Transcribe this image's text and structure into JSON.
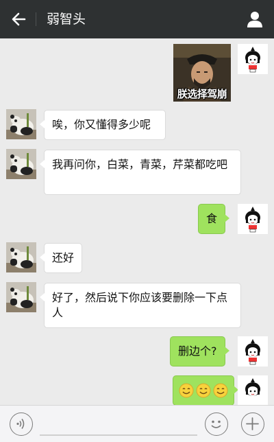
{
  "header": {
    "title": "弱智头"
  },
  "messages": [
    {
      "side": "right",
      "type": "sticker",
      "caption": "朕选择驾崩"
    },
    {
      "side": "left",
      "type": "text",
      "text": "唉，你又懂得多少呢"
    },
    {
      "side": "left",
      "type": "text",
      "text": "我再问你，白菜，青菜，芹菜都吃吧"
    },
    {
      "side": "right",
      "type": "text",
      "text": "食"
    },
    {
      "side": "left",
      "type": "text",
      "text": "还好"
    },
    {
      "side": "left",
      "type": "text",
      "text": "好了，然后说下你应该要删除一下点人"
    },
    {
      "side": "right",
      "type": "text",
      "text": "删边个?"
    },
    {
      "side": "right",
      "type": "emoji",
      "emoji": [
        "smile-emoji",
        "smile-emoji",
        "smile-emoji"
      ]
    }
  ],
  "icons": {
    "back": "arrow-left-icon",
    "profile": "person-icon",
    "voice": "voice-icon",
    "emoji": "emoji-icon",
    "plus": "plus-icon"
  },
  "colors": {
    "topbar": "#2e3132",
    "chat_background": "#ebebeb",
    "sent_bubble": "#9fe25e",
    "received_bubble": "#ffffff"
  }
}
